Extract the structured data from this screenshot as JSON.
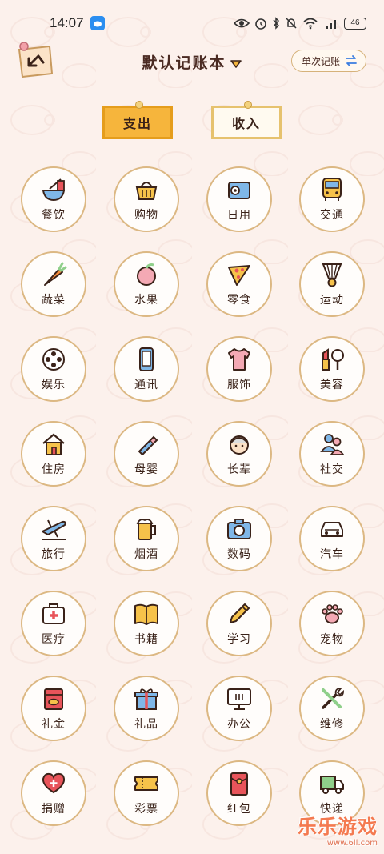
{
  "status": {
    "time": "14:07",
    "battery": "46"
  },
  "header": {
    "title": "默认记账本",
    "single_entry_label": "单次记账"
  },
  "tabs": [
    {
      "label": "支出",
      "active": true
    },
    {
      "label": "收入",
      "active": false
    }
  ],
  "categories": [
    {
      "label": "餐饮",
      "icon": "bowl-icon"
    },
    {
      "label": "购物",
      "icon": "basket-icon"
    },
    {
      "label": "日用",
      "icon": "tissue-icon"
    },
    {
      "label": "交通",
      "icon": "bus-icon"
    },
    {
      "label": "蔬菜",
      "icon": "carrot-icon"
    },
    {
      "label": "水果",
      "icon": "peach-icon"
    },
    {
      "label": "零食",
      "icon": "pizza-icon"
    },
    {
      "label": "运动",
      "icon": "shuttlecock-icon"
    },
    {
      "label": "娱乐",
      "icon": "film-reel-icon"
    },
    {
      "label": "通讯",
      "icon": "phone-icon"
    },
    {
      "label": "服饰",
      "icon": "shirt-icon"
    },
    {
      "label": "美容",
      "icon": "lipstick-icon"
    },
    {
      "label": "住房",
      "icon": "house-icon"
    },
    {
      "label": "母婴",
      "icon": "baby-bottle-icon"
    },
    {
      "label": "长辈",
      "icon": "grandma-icon"
    },
    {
      "label": "社交",
      "icon": "people-icon"
    },
    {
      "label": "旅行",
      "icon": "airplane-icon"
    },
    {
      "label": "烟酒",
      "icon": "beer-icon"
    },
    {
      "label": "数码",
      "icon": "camera-icon"
    },
    {
      "label": "汽车",
      "icon": "car-icon"
    },
    {
      "label": "医疗",
      "icon": "medkit-icon"
    },
    {
      "label": "书籍",
      "icon": "book-icon"
    },
    {
      "label": "学习",
      "icon": "pencil-icon"
    },
    {
      "label": "宠物",
      "icon": "paw-icon"
    },
    {
      "label": "礼金",
      "icon": "cash-gift-icon"
    },
    {
      "label": "礼品",
      "icon": "gift-box-icon"
    },
    {
      "label": "办公",
      "icon": "monitor-icon"
    },
    {
      "label": "维修",
      "icon": "tools-icon"
    },
    {
      "label": "捐赠",
      "icon": "donate-heart-icon"
    },
    {
      "label": "彩票",
      "icon": "ticket-icon"
    },
    {
      "label": "红包",
      "icon": "red-envelope-icon"
    },
    {
      "label": "快递",
      "icon": "truck-icon"
    }
  ],
  "watermark": {
    "name": "乐乐游戏",
    "url": "www.6ll.com"
  },
  "colors": {
    "accent": "#f6b53c",
    "border": "#dcb883",
    "background": "#fcf1ec",
    "icon_red": "#e8545a"
  }
}
